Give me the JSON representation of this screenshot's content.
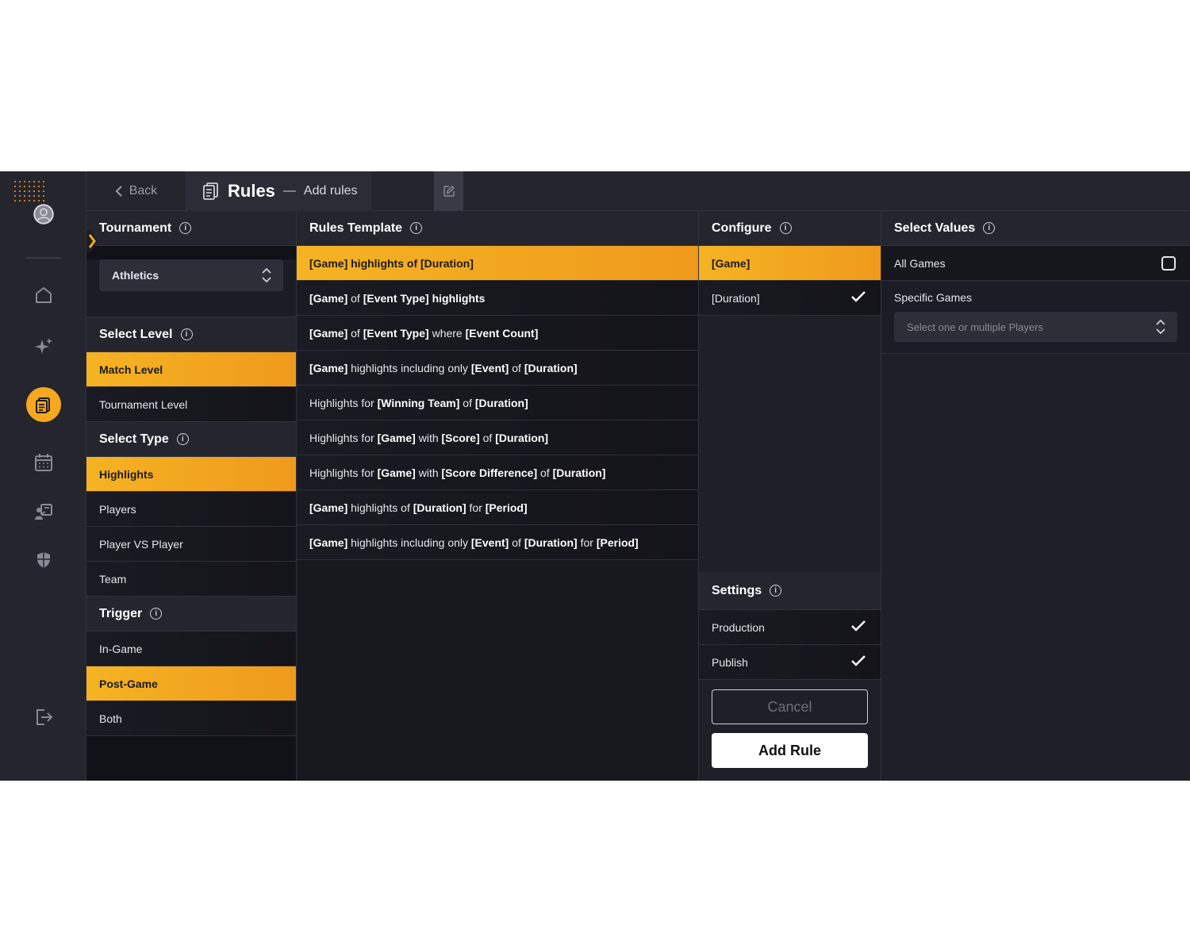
{
  "topbar": {
    "back_label": "Back",
    "title": "Rules",
    "separator": "—",
    "subtitle": "Add rules"
  },
  "tournament": {
    "header": "Tournament",
    "selected": "Athletics"
  },
  "select_level": {
    "header": "Select Level",
    "items": [
      {
        "label": "Match Level",
        "selected": true
      },
      {
        "label": "Tournament Level",
        "selected": false
      }
    ]
  },
  "select_type": {
    "header": "Select Type",
    "items": [
      {
        "label": "Highlights",
        "selected": true
      },
      {
        "label": "Players",
        "selected": false
      },
      {
        "label": "Player VS Player",
        "selected": false
      },
      {
        "label": "Team",
        "selected": false
      }
    ]
  },
  "trigger": {
    "header": "Trigger",
    "items": [
      {
        "label": "In-Game",
        "selected": false
      },
      {
        "label": "Post-Game",
        "selected": true
      },
      {
        "label": "Both",
        "selected": false
      }
    ]
  },
  "rules_template": {
    "header": "Rules Template",
    "items": [
      {
        "parts": [
          [
            "b",
            "[Game]"
          ],
          [
            "t",
            " highlights of "
          ],
          [
            "b",
            "[Duration]"
          ]
        ],
        "selected": true
      },
      {
        "parts": [
          [
            "b",
            "[Game]"
          ],
          [
            "t",
            " of "
          ],
          [
            "b",
            "[Event Type]"
          ],
          [
            "b",
            " highlights"
          ]
        ],
        "selected": false
      },
      {
        "parts": [
          [
            "b",
            "[Game]"
          ],
          [
            "t",
            " of "
          ],
          [
            "b",
            "[Event Type]"
          ],
          [
            "t",
            " where "
          ],
          [
            "b",
            "[Event Count]"
          ]
        ],
        "selected": false
      },
      {
        "parts": [
          [
            "b",
            "[Game]"
          ],
          [
            "t",
            " highlights including only "
          ],
          [
            "b",
            "[Event]"
          ],
          [
            "t",
            " of "
          ],
          [
            "b",
            "[Duration]"
          ]
        ],
        "selected": false
      },
      {
        "parts": [
          [
            "t",
            "Highlights for "
          ],
          [
            "b",
            "[Winning Team]"
          ],
          [
            "t",
            " of "
          ],
          [
            "b",
            "[Duration]"
          ]
        ],
        "selected": false
      },
      {
        "parts": [
          [
            "t",
            "Highlights for "
          ],
          [
            "b",
            "[Game]"
          ],
          [
            "t",
            " with "
          ],
          [
            "b",
            "[Score]"
          ],
          [
            "t",
            " of "
          ],
          [
            "b",
            "[Duration]"
          ]
        ],
        "selected": false
      },
      {
        "parts": [
          [
            "t",
            "Highlights for "
          ],
          [
            "b",
            "[Game]"
          ],
          [
            "t",
            " with "
          ],
          [
            "b",
            "[Score Difference]"
          ],
          [
            "t",
            " of "
          ],
          [
            "b",
            "[Duration]"
          ]
        ],
        "selected": false
      },
      {
        "parts": [
          [
            "b",
            "[Game]"
          ],
          [
            "t",
            " highlights of "
          ],
          [
            "b",
            "[Duration]"
          ],
          [
            "t",
            " for "
          ],
          [
            "b",
            "[Period]"
          ]
        ],
        "selected": false
      },
      {
        "parts": [
          [
            "b",
            "[Game]"
          ],
          [
            "t",
            " highlights including only "
          ],
          [
            "b",
            "[Event]"
          ],
          [
            "t",
            " of "
          ],
          [
            "b",
            "[Duration]"
          ],
          [
            "t",
            " for "
          ],
          [
            "b",
            "[Period]"
          ]
        ],
        "selected": false
      }
    ]
  },
  "configure": {
    "header": "Configure",
    "items": [
      {
        "label": "[Game]",
        "selected": true,
        "checked": false
      },
      {
        "label": "[Duration]",
        "selected": false,
        "checked": true
      }
    ]
  },
  "settings": {
    "header": "Settings",
    "items": [
      {
        "label": "Production",
        "checked": true
      },
      {
        "label": "Publish",
        "checked": true
      }
    ],
    "cancel_label": "Cancel",
    "add_label": "Add Rule"
  },
  "select_values": {
    "header": "Select Values",
    "all_games_label": "All Games",
    "all_games_checked": false,
    "specific_label": "Specific Games",
    "specific_placeholder": "Select one or multiple Players"
  },
  "colors": {
    "accent": "#f6a81f",
    "background": "#1c1c24"
  }
}
